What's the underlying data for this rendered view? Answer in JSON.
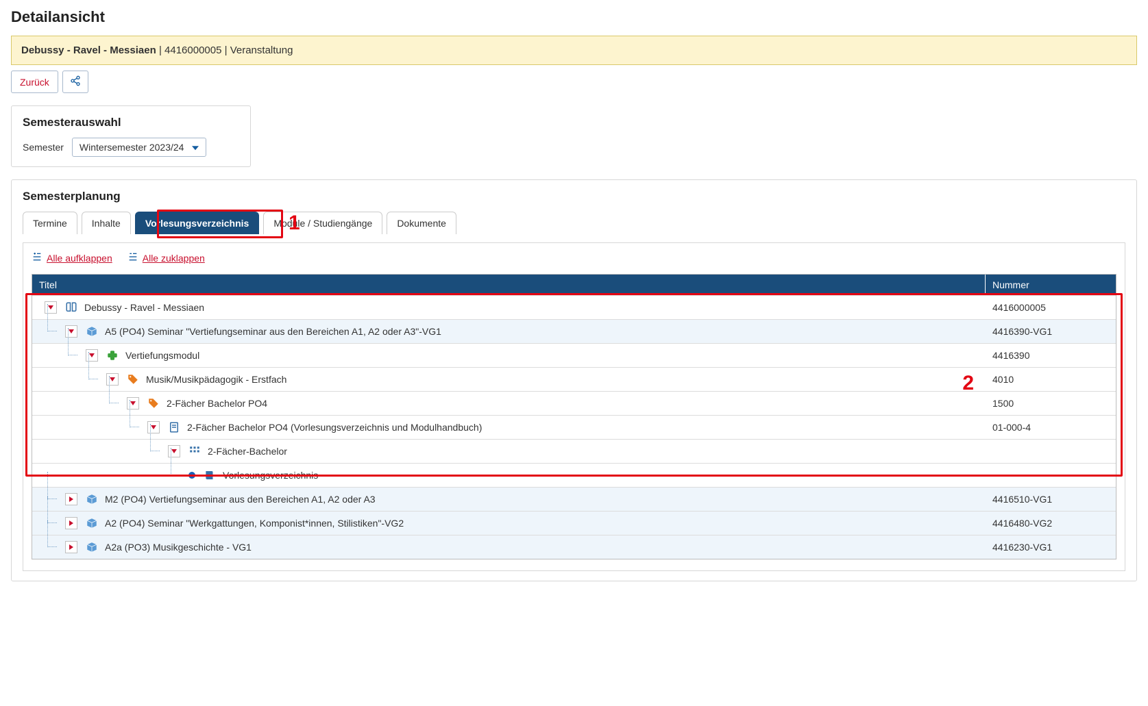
{
  "page_title": "Detailansicht",
  "info": {
    "course_name": "Debussy - Ravel - Messiaen",
    "course_id": "4416000005",
    "type": "Veranstaltung"
  },
  "toolbar": {
    "back_label": "Zurück"
  },
  "semester_panel": {
    "title": "Semesterauswahl",
    "field_label": "Semester",
    "selected": "Wintersemester 2023/24"
  },
  "planning": {
    "title": "Semesterplanung",
    "tabs": [
      "Termine",
      "Inhalte",
      "Vorlesungsverzeichnis",
      "Module / Studiengänge",
      "Dokumente"
    ],
    "active_tab": 2,
    "expand_all": "Alle aufklappen",
    "collapse_all": "Alle zuklappen",
    "columns": {
      "title": "Titel",
      "number": "Nummer"
    },
    "annotations": {
      "n1": "1",
      "n2": "2"
    },
    "rows": [
      {
        "level": 0,
        "toggle": "down",
        "icon": "book",
        "label": "Debussy - Ravel - Messiaen",
        "number": "4416000005",
        "alt": false
      },
      {
        "level": 1,
        "toggle": "down",
        "icon": "pkg",
        "label": "A5 (PO4) Seminar \"Vertiefungseminar aus den Bereichen A1, A2 oder A3\"-VG1",
        "number": "4416390-VG1",
        "alt": true
      },
      {
        "level": 2,
        "toggle": "down",
        "icon": "puzzle",
        "label": "Vertiefungsmodul",
        "number": "4416390",
        "alt": false
      },
      {
        "level": 3,
        "toggle": "down",
        "icon": "tag",
        "label": "Musik/Musikpädagogik - Erstfach",
        "number": "4010",
        "alt": false
      },
      {
        "level": 4,
        "toggle": "down",
        "icon": "tag",
        "label": "2-Fächer Bachelor PO4",
        "number": "1500",
        "alt": false
      },
      {
        "level": 5,
        "toggle": "down",
        "icon": "doc",
        "label": "2-Fächer Bachelor PO4 (Vorlesungsverzeichnis und Modulhandbuch)",
        "number": "01-000-4",
        "alt": false
      },
      {
        "level": 6,
        "toggle": "down",
        "icon": "grid",
        "label": "2-Fächer-Bachelor",
        "number": "",
        "alt": false
      },
      {
        "level": 7,
        "toggle": "bullet",
        "icon": "book2",
        "label": "Vorlesungsverzeichnis",
        "number": "",
        "alt": false
      },
      {
        "level": 1,
        "toggle": "right",
        "icon": "pkg",
        "label": "M2 (PO4) Vertiefungseminar aus den Bereichen A1, A2 oder A3",
        "number": "4416510-VG1",
        "alt": true
      },
      {
        "level": 1,
        "toggle": "right",
        "icon": "pkg",
        "label": "A2 (PO4) Seminar \"Werkgattungen, Komponist*innen, Stilistiken\"-VG2",
        "number": "4416480-VG2",
        "alt": true
      },
      {
        "level": 1,
        "toggle": "right",
        "icon": "pkg",
        "label": "A2a (PO3) Musikgeschichte - VG1",
        "number": "4416230-VG1",
        "alt": true
      }
    ]
  }
}
